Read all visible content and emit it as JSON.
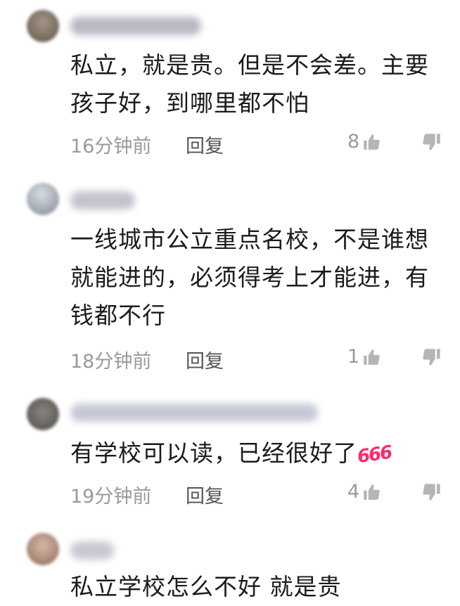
{
  "comments": [
    {
      "text_lines": [
        "私立，就是贵。但是不会差。主要",
        "孩子好，到哪里都不怕"
      ],
      "time": "16分钟前",
      "reply_label": "回复",
      "likes": "8"
    },
    {
      "text_lines": [
        "一线城市公立重点名校，不是谁想",
        "就能进的，必须得考上才能进，有",
        "钱都不行"
      ],
      "time": "18分钟前",
      "reply_label": "回复",
      "likes": "1"
    },
    {
      "text_lines": [
        "有学校可以读，已经很好了"
      ],
      "emoji": "666",
      "time": "19分钟前",
      "reply_label": "回复",
      "likes": "4"
    },
    {
      "text_lines": [
        "私立学校怎么不好 就是贵"
      ]
    }
  ],
  "icons": {
    "like": "thumbs-up-icon",
    "dislike": "thumbs-down-icon"
  },
  "colors": {
    "text": "#1b1b1b",
    "meta": "#9a9a9a",
    "emoji": "#ff2a6d"
  }
}
